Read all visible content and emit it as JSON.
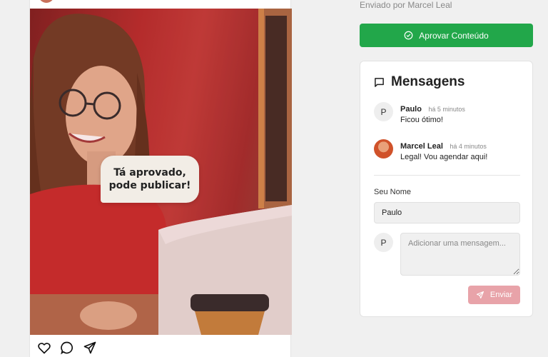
{
  "post": {
    "image_caption": "Tá aprovado,\npode publicar!",
    "caption_line1": "Tá aprovado,",
    "caption_line2": "pode publicar!",
    "actions": [
      "heart-icon",
      "comment-icon",
      "share-icon"
    ]
  },
  "sidebar": {
    "sent_by": "Enviado por Marcel Leal",
    "approve_label": "Aprovar Conteúdo",
    "approve_color": "#22a74a"
  },
  "messages": {
    "title": "Mensagens",
    "items": [
      {
        "avatar": "P",
        "author": "Paulo",
        "time": "há 5 minutos",
        "text": "Ficou ótimo!"
      },
      {
        "avatar": "photo",
        "author": "Marcel Leal",
        "time": "há 4 minutos",
        "text": "Legal! Vou agendar aqui!"
      }
    ],
    "name_label": "Seu Nome",
    "name_value": "Paulo",
    "compose_avatar": "P",
    "compose_placeholder": "Adicionar uma mensagem...",
    "send_label": "Enviar",
    "send_color": "#e8a3a9"
  }
}
